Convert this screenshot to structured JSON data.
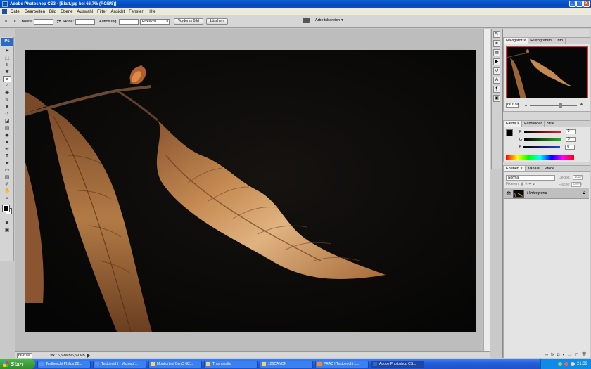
{
  "window": {
    "title": "Adobe Photoshop CS3 - [Blatt.jpg bei 66,7% (RGB/8)]"
  },
  "menu": [
    "Datei",
    "Bearbeiten",
    "Bild",
    "Ebene",
    "Auswahl",
    "Filter",
    "Ansicht",
    "Fenster",
    "Hilfe"
  ],
  "options": {
    "width_label": "Breite:",
    "height_label": "Höhe:",
    "resolution_label": "Auflösung:",
    "unit": "Pixel/Zoll",
    "front_image_button": "Vorderes Bild",
    "clear_button": "Löschen",
    "workspace": "Arbeitsbereich"
  },
  "toolbox": {
    "logo": "Ps"
  },
  "status": {
    "zoom": "66,67%",
    "doc_size": "Dok.: 6,59 MB/6,59 MB"
  },
  "navigator": {
    "tabs": [
      "Navigator",
      "Histogramm",
      "Info"
    ],
    "zoom": "66.67%"
  },
  "color_panel": {
    "tabs": [
      "Farbe",
      "Farbfelder",
      "Stile"
    ],
    "channels": [
      {
        "label": "R",
        "value": "0",
        "color": "#e02020"
      },
      {
        "label": "G",
        "value": "0",
        "color": "#20b020"
      },
      {
        "label": "B",
        "value": "0",
        "color": "#2040e0"
      }
    ]
  },
  "layers_panel": {
    "tabs": [
      "Ebenen",
      "Kanäle",
      "Pfade"
    ],
    "blend_mode": "Normal",
    "opacity_label": "Deckkr.:",
    "opacity": "100%",
    "lock_label": "Fixieren:",
    "fill_label": "Fläche:",
    "fill": "100%",
    "layer_name": "Hintergrund"
  },
  "taskbar": {
    "start": "Start",
    "tasks": [
      "Testbericht Philips 22...",
      "Testbericht - Microsof...",
      "Monitortest BenQ G2...",
      "Thumbnails",
      "100CANON",
      "PRAD | Testbericht L...",
      "Adobe Photoshop CS..."
    ],
    "active_index": 6,
    "clock": "21:39"
  }
}
